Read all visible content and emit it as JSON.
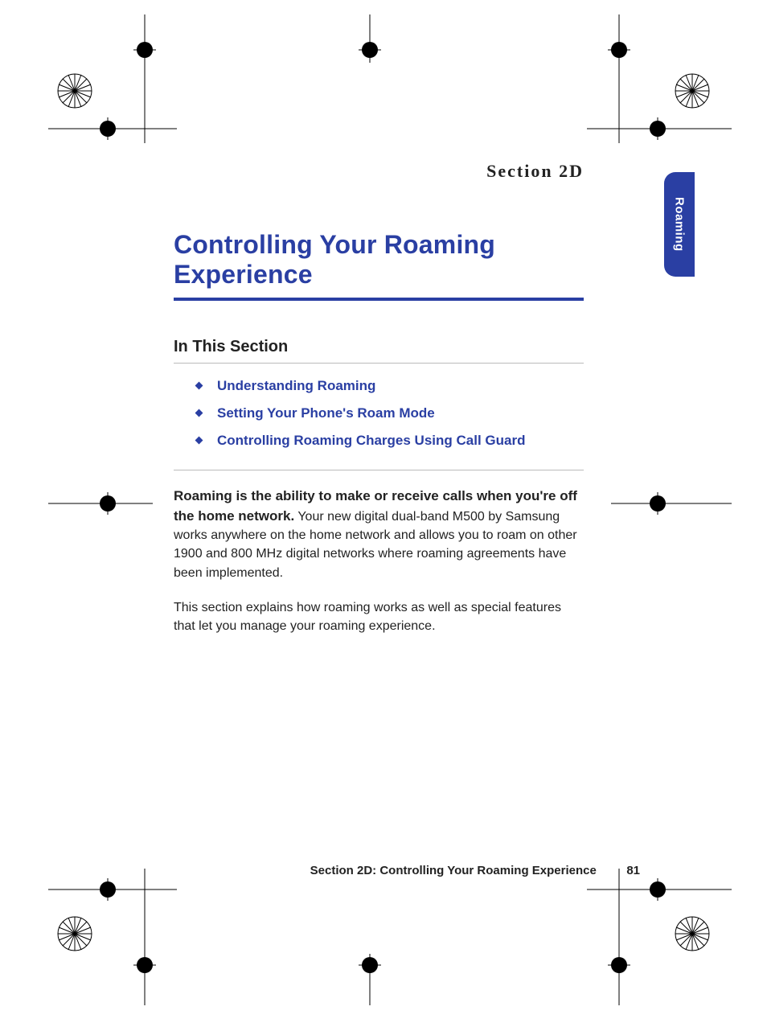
{
  "section_label": "Section 2D",
  "title": "Controlling Your Roaming Experience",
  "sidetab": "Roaming",
  "subhead": "In This Section",
  "toc": [
    "Understanding Roaming",
    "Setting Your Phone's Roam Mode",
    "Controlling Roaming Charges Using Call Guard"
  ],
  "para1_lead": "Roaming is the ability to make or receive calls when you're off the home network.",
  "para1_rest": " Your new digital dual-band M500 by Samsung works anywhere on the home network and allows you to roam on other 1900 and 800 MHz digital networks where roaming agreements have been implemented.",
  "para2": "This section explains how roaming works as well as special features that let you manage your roaming experience.",
  "footer_text": "Section 2D: Controlling Your Roaming Experience",
  "page_number": "81"
}
